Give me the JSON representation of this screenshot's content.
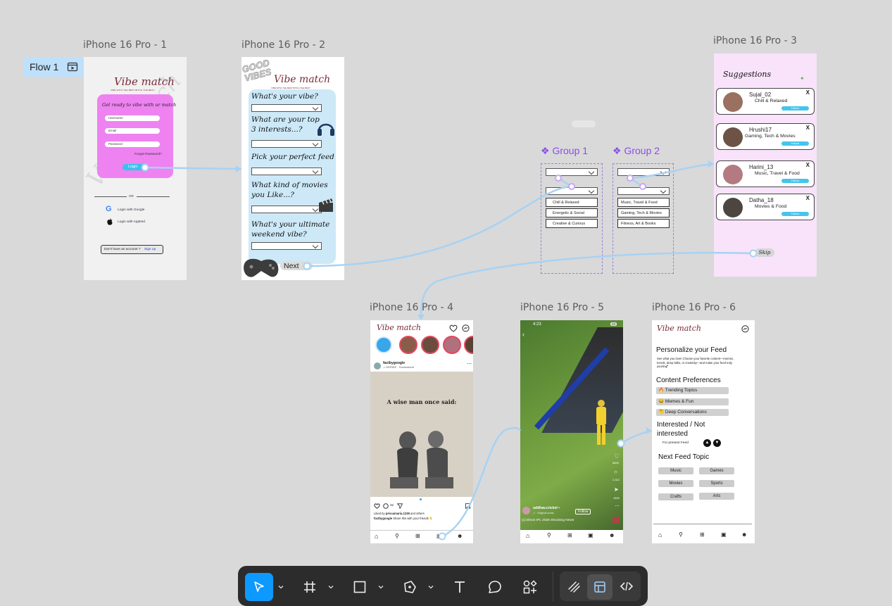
{
  "flow": {
    "label": "Flow 1",
    "icon": "play-frame-icon"
  },
  "frames": {
    "f1": "iPhone 16 Pro - 1",
    "f2": "iPhone 16 Pro - 2",
    "f3": "iPhone 16 Pro - 3",
    "f4": "iPhone 16 Pro - 4",
    "f5": "iPhone 16 Pro - 5",
    "f6": "iPhone 16 Pro - 6"
  },
  "login": {
    "logo": "Vibe match",
    "tagline": "VIBE WITH THE BEST BITCH THE BEST",
    "heading": "Get ready to vibe with ur match",
    "username": "Username",
    "email": "Email",
    "password": "Password",
    "forgot": "Forgot Password?",
    "login_btn": "Login",
    "or": "OR",
    "google": "Login with Google",
    "apple": "Login with AppleId",
    "signup_prefix": "Don't have an account ?",
    "signup": "Sign up",
    "watermark": "Vibe match"
  },
  "quiz": {
    "logo": "Vibe match",
    "tagline": "VIBE WITH THE BEST BITCH THE BEST",
    "sticker": "GOOD VIBES",
    "q1": "What's your vibe?",
    "q2": "What are your top 3 interests...?",
    "q3": "Pick your perfect feed",
    "q4": "What kind of movies you Like...?",
    "q5": "What's your ultimate weekend vibe?",
    "next": "Next"
  },
  "groups": {
    "g1": {
      "title": "Group 1",
      "items": [
        "Chill & Relaxed",
        "Energetic & Social",
        "Creative & Curious"
      ]
    },
    "g2": {
      "title": "Group 2",
      "items": [
        "Music, Travel & Food",
        "Gaming, Tech & Movies",
        "Fitness, Art & Books"
      ]
    }
  },
  "suggestions": {
    "title": "Suggestions",
    "users": [
      {
        "name": "Sujal_02",
        "interests": "Chill & Relaxed",
        "follow": "Follow",
        "close": "X"
      },
      {
        "name": "Hrushi17",
        "interests": "Gaming, Tech & Movies",
        "follow": "Follow",
        "close": "X"
      },
      {
        "name": "Harini_13",
        "interests": "Music, Travel & Food",
        "follow": "Follow",
        "close": "X"
      },
      {
        "name": "Datha_18",
        "interests": "Movies & Food",
        "follow": "Follow",
        "close": "X"
      }
    ],
    "skip": "Skip"
  },
  "feed": {
    "logo": "Vibe match",
    "account": "factbygoogle",
    "sub": "♫ GERIKE · Somewhere",
    "post_text": "A wise man once said:",
    "likes_count": "32",
    "liked_by": "Liked by",
    "liked_user": "priscamaria.1238",
    "liked_others": "and others",
    "caption_user": "factbygoogle",
    "caption": "Share this with your friends 👇"
  },
  "reel": {
    "time": "4:23",
    "battery": "23",
    "user": "uddhav.cricket •",
    "follow": "Follow",
    "audio": "♫ · Original audio",
    "caption": "(c) Dhoni IPL 2025 Shocking News",
    "likes": "8600",
    "comments": "2,312",
    "shares": "1600"
  },
  "personalize": {
    "logo": "Vibe match",
    "title": "Personalize your Feed",
    "desc": "See what you love! Choose your favorite content—memes, trends, deep talks, or creativity—and make your feed truly yours!🚀",
    "prefs_title": "Content Preferences",
    "prefs": [
      "🔥 Trending Topics",
      "😂 Memes & Fun",
      "🤔 Deep Conversations"
    ],
    "interest_title": "Interested / Not interested",
    "present_feed": "For present Feed",
    "next_title": "Next Feed Topic",
    "topics": [
      "Music",
      "Games",
      "Movies",
      "Sports",
      "Crafts",
      "Arts"
    ]
  },
  "toolbar": {
    "tools": [
      "move-tool",
      "frame-tool",
      "shape-tool",
      "pen-tool",
      "text-tool",
      "comment-tool",
      "actions-tool"
    ],
    "modes": [
      "draw-mode",
      "design-mode",
      "dev-mode"
    ]
  },
  "colors": {
    "canvas": "#d9d9d9",
    "accent": "#0d99ff",
    "pink_card": "#ee82f1",
    "quiz_panel": "#cde9f8",
    "suggest_bg": "#f8e3fb",
    "connector": "#a8d2f2",
    "group_purple": "#8b4ee8",
    "logo_maroon": "#7a2b3a"
  }
}
